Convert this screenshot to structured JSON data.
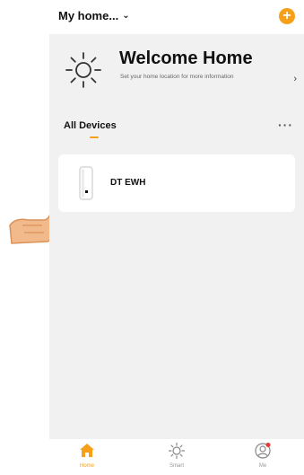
{
  "header": {
    "home_name": "My home...",
    "add_icon": "plus-circle-icon"
  },
  "welcome": {
    "title": "Welcome Home",
    "subtitle": "Set your home location for more information",
    "icon": "sun-icon",
    "arrow": "›"
  },
  "section": {
    "title": "All Devices",
    "more": "···"
  },
  "devices": [
    {
      "name": "DT EWH",
      "icon": "water-heater-icon"
    }
  ],
  "tabs": [
    {
      "label": "Home",
      "icon": "home-icon",
      "active": true
    },
    {
      "label": "Smart",
      "icon": "smart-sun-icon",
      "active": false
    },
    {
      "label": "Me",
      "icon": "profile-icon",
      "active": false
    }
  ],
  "colors": {
    "accent": "#f6a01a",
    "background": "#f1f1f1",
    "badge": "#e53935"
  }
}
